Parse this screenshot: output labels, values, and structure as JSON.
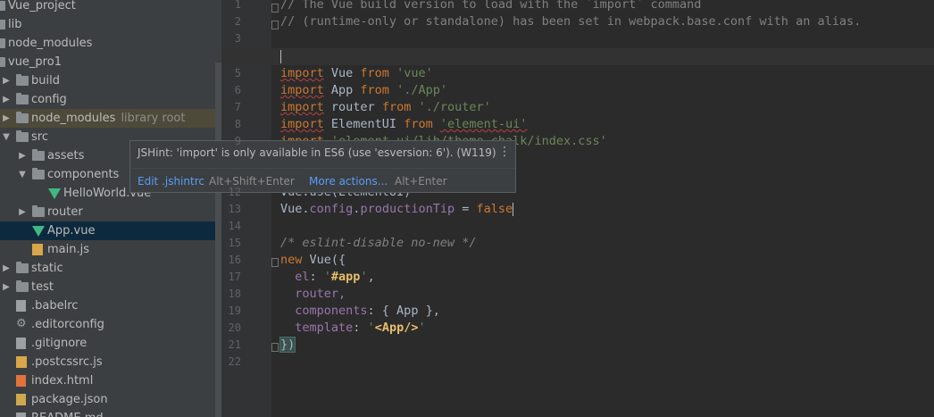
{
  "project_tree": {
    "items": [
      {
        "label": "Vue_project",
        "type": "folder",
        "depth": 0,
        "expanded": true
      },
      {
        "label": "lib",
        "type": "folder",
        "depth": 0
      },
      {
        "label": "node_modules",
        "type": "folder",
        "depth": 0
      },
      {
        "label": "vue_pro1",
        "type": "folder",
        "depth": 0,
        "expanded": true
      },
      {
        "label": "build",
        "type": "folder",
        "depth": 1
      },
      {
        "label": "config",
        "type": "folder",
        "depth": 1
      },
      {
        "label": "node_modules",
        "type": "folder",
        "depth": 1,
        "hint": "library root"
      },
      {
        "label": "src",
        "type": "folder",
        "depth": 1,
        "expanded": true
      },
      {
        "label": "assets",
        "type": "folder",
        "depth": 2
      },
      {
        "label": "components",
        "type": "folder",
        "depth": 2,
        "expanded": true
      },
      {
        "label": "HelloWorld.vue",
        "type": "vue",
        "depth": 3
      },
      {
        "label": "router",
        "type": "folder",
        "depth": 2
      },
      {
        "label": "App.vue",
        "type": "vue",
        "depth": 2,
        "selected": true
      },
      {
        "label": "main.js",
        "type": "js",
        "depth": 2
      },
      {
        "label": "static",
        "type": "folder",
        "depth": 1
      },
      {
        "label": "test",
        "type": "folder",
        "depth": 1
      },
      {
        "label": ".babelrc",
        "type": "text",
        "depth": 1
      },
      {
        "label": ".editorconfig",
        "type": "gear",
        "depth": 1
      },
      {
        "label": ".gitignore",
        "type": "text",
        "depth": 1
      },
      {
        "label": ".postcssrc.js",
        "type": "js",
        "depth": 1
      },
      {
        "label": "index.html",
        "type": "html",
        "depth": 1
      },
      {
        "label": "package.json",
        "type": "json",
        "depth": 1
      },
      {
        "label": "README.md",
        "type": "text",
        "depth": 1
      }
    ]
  },
  "editor": {
    "line_numbers": [
      "1",
      "2",
      "3",
      "",
      "5",
      "6",
      "7",
      "8",
      "9",
      "",
      "",
      "12",
      "13",
      "14",
      "15",
      "16",
      "17",
      "18",
      "19",
      "20",
      "21",
      "22"
    ],
    "lines": {
      "l1": "// The Vue build version to load with the `import` command",
      "l2": "// (runtime-only or standalone) has been set in webpack.base.conf with an alias.",
      "l5_kw": "import",
      "l5_id": " Vue ",
      "l5_from": "from",
      "l5_str": "'vue'",
      "l6_kw": "import",
      "l6_id": " App ",
      "l6_from": "from",
      "l6_str": "'./App'",
      "l7_kw": "import",
      "l7_id": " router ",
      "l7_from": "from",
      "l7_str": "'./router'",
      "l8_kw": "import",
      "l8_id": " ElementUI ",
      "l8_from": "from",
      "l8_str": "'element-ui'",
      "l9_kw": "import",
      "l9_str": "'element-ui/lib/theme-chalk/index.css'",
      "l12": "Vue.use(ElementUI)",
      "l13_a": "Vue.",
      "l13_b": "config",
      "l13_c": ".",
      "l13_d": "productionTip",
      "l13_e": " = ",
      "l13_f": "false",
      "l15": "/* eslint-disable no-new */",
      "l16_kw": "new",
      "l16_rest": " Vue({",
      "l17_p": "  el",
      "l17_c": ": ",
      "l17_s1": "'",
      "l17_sb": "#app",
      "l17_s2": "'",
      "l17_e": ",",
      "l18": "  router,",
      "l19_p": "  components",
      "l19_r": ": { App },",
      "l20_p": "  template",
      "l20_c": ": ",
      "l20_s1": "'",
      "l20_sb": "<App/>",
      "l20_s2": "'",
      "l21_a": "})"
    }
  },
  "tooltip": {
    "message": "JSHint: 'import' is only available in ES6 (use 'esversion: 6'). (W119)",
    "action1": "Edit .jshintrc",
    "action1_key": "Alt+Shift+Enter",
    "action2": "More actions...",
    "action2_key": "Alt+Enter"
  },
  "colors": {
    "keyword": "#cc7832",
    "string": "#6a8759",
    "comment": "#808080",
    "link": "#589df6",
    "vue_icon": "#41b883"
  }
}
